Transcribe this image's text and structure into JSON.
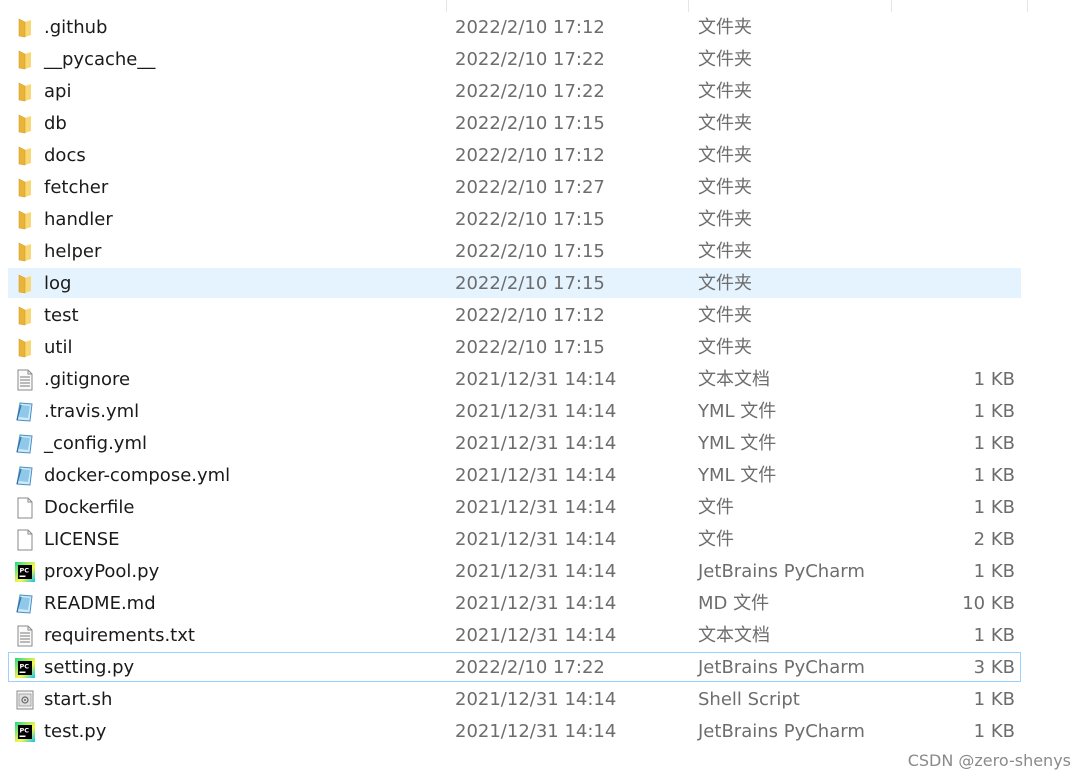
{
  "colors": {
    "hover": "#e5f3ff",
    "focus_border": "#99d1ff",
    "folder": "#f8d775",
    "pycharm_bg": "#21d789"
  },
  "files": [
    {
      "name": ".github",
      "date": "2022/2/10 17:12",
      "type": "文件夹",
      "size": "",
      "icon": "folder-icon"
    },
    {
      "name": "__pycache__",
      "date": "2022/2/10 17:22",
      "type": "文件夹",
      "size": "",
      "icon": "folder-icon"
    },
    {
      "name": "api",
      "date": "2022/2/10 17:22",
      "type": "文件夹",
      "size": "",
      "icon": "folder-icon"
    },
    {
      "name": "db",
      "date": "2022/2/10 17:15",
      "type": "文件夹",
      "size": "",
      "icon": "folder-icon"
    },
    {
      "name": "docs",
      "date": "2022/2/10 17:12",
      "type": "文件夹",
      "size": "",
      "icon": "folder-icon"
    },
    {
      "name": "fetcher",
      "date": "2022/2/10 17:27",
      "type": "文件夹",
      "size": "",
      "icon": "folder-icon"
    },
    {
      "name": "handler",
      "date": "2022/2/10 17:15",
      "type": "文件夹",
      "size": "",
      "icon": "folder-icon"
    },
    {
      "name": "helper",
      "date": "2022/2/10 17:15",
      "type": "文件夹",
      "size": "",
      "icon": "folder-icon"
    },
    {
      "name": "log",
      "date": "2022/2/10 17:15",
      "type": "文件夹",
      "size": "",
      "icon": "folder-icon",
      "state": "hover"
    },
    {
      "name": "test",
      "date": "2022/2/10 17:12",
      "type": "文件夹",
      "size": "",
      "icon": "folder-icon"
    },
    {
      "name": "util",
      "date": "2022/2/10 17:15",
      "type": "文件夹",
      "size": "",
      "icon": "folder-icon"
    },
    {
      "name": ".gitignore",
      "date": "2021/12/31 14:14",
      "type": "文本文档",
      "size": "1 KB",
      "icon": "text-file-icon"
    },
    {
      "name": ".travis.yml",
      "date": "2021/12/31 14:14",
      "type": "YML 文件",
      "size": "1 KB",
      "icon": "yml-file-icon"
    },
    {
      "name": "_config.yml",
      "date": "2021/12/31 14:14",
      "type": "YML 文件",
      "size": "1 KB",
      "icon": "yml-file-icon"
    },
    {
      "name": "docker-compose.yml",
      "date": "2021/12/31 14:14",
      "type": "YML 文件",
      "size": "1 KB",
      "icon": "yml-file-icon"
    },
    {
      "name": "Dockerfile",
      "date": "2021/12/31 14:14",
      "type": "文件",
      "size": "1 KB",
      "icon": "blank-file-icon"
    },
    {
      "name": "LICENSE",
      "date": "2021/12/31 14:14",
      "type": "文件",
      "size": "2 KB",
      "icon": "blank-file-icon"
    },
    {
      "name": "proxyPool.py",
      "date": "2021/12/31 14:14",
      "type": "JetBrains PyCharm",
      "size": "1 KB",
      "icon": "pycharm-icon"
    },
    {
      "name": "README.md",
      "date": "2021/12/31 14:14",
      "type": "MD 文件",
      "size": "10 KB",
      "icon": "yml-file-icon"
    },
    {
      "name": "requirements.txt",
      "date": "2021/12/31 14:14",
      "type": "文本文档",
      "size": "1 KB",
      "icon": "text-file-icon"
    },
    {
      "name": "setting.py",
      "date": "2022/2/10 17:22",
      "type": "JetBrains PyCharm",
      "size": "3 KB",
      "icon": "pycharm-icon",
      "state": "focused"
    },
    {
      "name": "start.sh",
      "date": "2021/12/31 14:14",
      "type": "Shell Script",
      "size": "1 KB",
      "icon": "shell-script-icon"
    },
    {
      "name": "test.py",
      "date": "2021/12/31 14:14",
      "type": "JetBrains PyCharm",
      "size": "1 KB",
      "icon": "pycharm-icon"
    }
  ],
  "watermark": "CSDN @zero-shenys"
}
